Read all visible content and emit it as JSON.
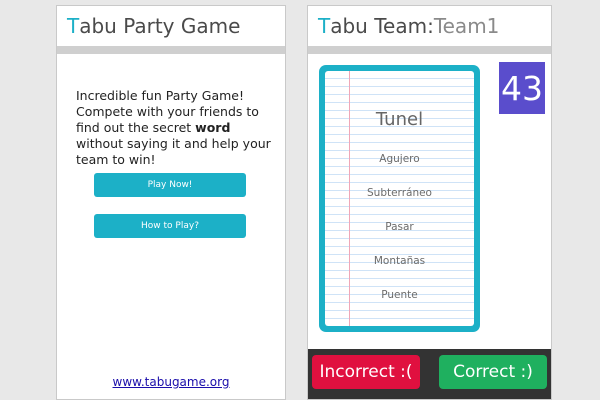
{
  "left_screen": {
    "title_first_letter": "T",
    "title_rest": "abu Party Game",
    "intro_text_1": "Incredible fun Party Game! Compete with your friends to find out the secret ",
    "intro_bold": "word",
    "intro_text_2": " without saying it and help your team to win!",
    "play_button": "Play Now!",
    "howto_button": "How to Play?",
    "link_text": "www.tabugame.org"
  },
  "right_screen": {
    "title_first_letter": "T",
    "title_rest": "abu Team: ",
    "team_name": "Team1",
    "timer_value": "43",
    "card": {
      "main_word": "Tunel",
      "forbidden_words": [
        "Agujero",
        "Subterráneo",
        "Pasar",
        "Montañas",
        "Puente"
      ]
    },
    "incorrect_button": "Incorrect :(",
    "correct_button": "Correct :)"
  },
  "colors": {
    "accent": "#1cb0c7",
    "timer_bg": "#5a4dcc",
    "incorrect": "#e0103f",
    "correct": "#1fb05f",
    "bar_bg": "#333333"
  }
}
